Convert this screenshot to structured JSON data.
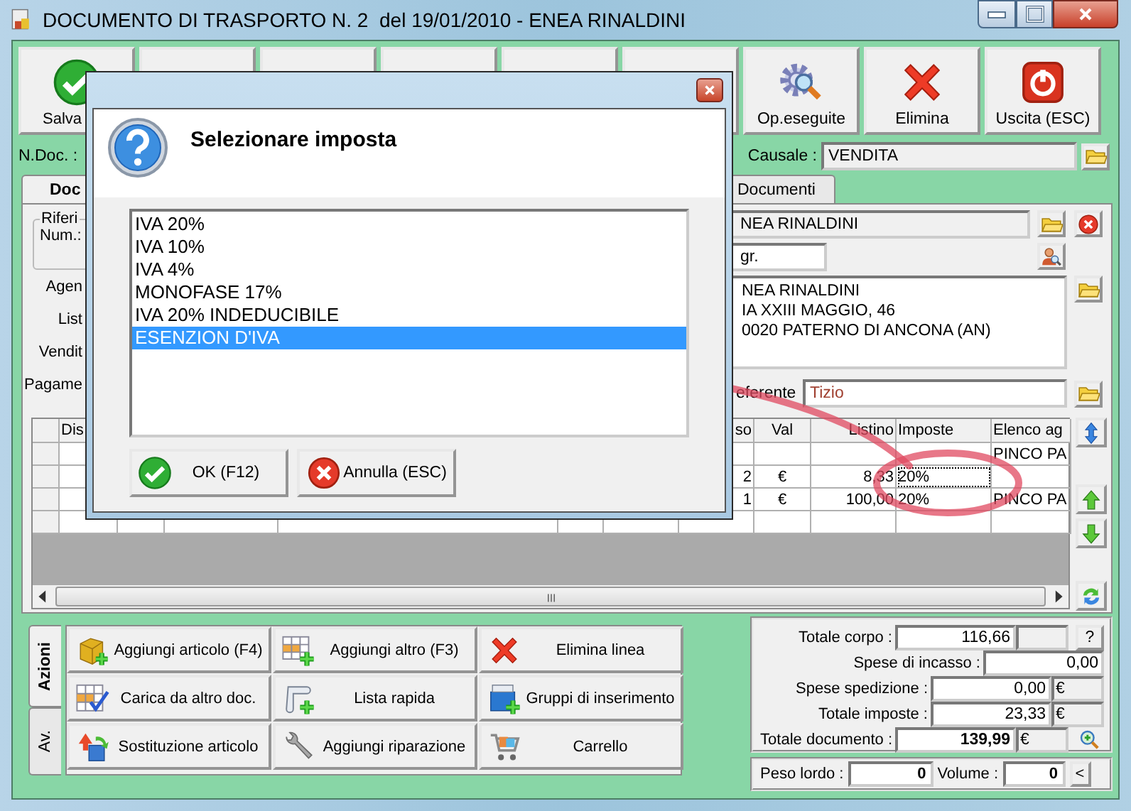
{
  "window": {
    "title": "DOCUMENTO DI TRASPORTO N. 2  del 19/01/2010 - ENEA RINALDINI"
  },
  "toolbar": [
    {
      "kind": "save",
      "label": "Salva"
    },
    {
      "kind": "covered"
    },
    {
      "kind": "covered"
    },
    {
      "kind": "covered"
    },
    {
      "kind": "covered"
    },
    {
      "kind": "covered"
    },
    {
      "kind": "gears",
      "label": "Op.eseguite"
    },
    {
      "kind": "delete",
      "label": "Elimina"
    },
    {
      "kind": "exit",
      "label": "Uscita (ESC)"
    }
  ],
  "header": {
    "ndoc_label": "N.Doc. :",
    "causale_label": "Causale :",
    "causale": "VENDITA"
  },
  "tabs": [
    {
      "label": "Doc",
      "selected": true
    },
    {
      "label": "Documenti",
      "selected": false
    }
  ],
  "document": {
    "group_label": "Riferi",
    "num_label": "Num.:",
    "left_labels": [
      "Agen",
      "List",
      "Vendit",
      "Pagame"
    ],
    "customer": "NEA RINALDINI",
    "title_field": "gr.",
    "address": [
      "NEA RINALDINI",
      "IA XXIII MAGGIO, 46",
      "0020 PATERNO DI ANCONA (AN)"
    ],
    "referente_label": "eferente",
    "referente": "Tizio"
  },
  "grid": {
    "columns": [
      "Dis",
      "so",
      "Val",
      "Listino",
      "Imposte",
      "Elenco ag"
    ],
    "rows": [
      {
        "elenco": "PINCO PA",
        "focused": false
      },
      {
        "so": "2",
        "val": "€",
        "listino": "8,33",
        "imposte": "20%",
        "focused": true
      },
      {
        "so": "1",
        "val": "€",
        "listino": "100,00",
        "imposte": "20%",
        "elenco": "PINCO PA",
        "focused": false
      }
    ]
  },
  "actions": {
    "tabs": [
      {
        "label": "Azioni",
        "selected": true
      },
      {
        "label": "Av.",
        "selected": false
      }
    ],
    "buttons": [
      {
        "kind": "cube-add",
        "label": "Aggiungi articolo (F4)"
      },
      {
        "kind": "grid-add",
        "label": "Aggiungi altro (F3)"
      },
      {
        "kind": "delete",
        "label": "Elimina linea"
      },
      {
        "kind": "grid-check",
        "label": "Carica da altro doc."
      },
      {
        "kind": "scroll-add",
        "label": "Lista rapida"
      },
      {
        "kind": "box-add",
        "label": "Gruppi di inserimento"
      },
      {
        "kind": "swap",
        "label": "Sostituzione articolo"
      },
      {
        "kind": "wrench",
        "label": "Aggiungi riparazione"
      },
      {
        "kind": "cart",
        "label": "Carrello"
      }
    ]
  },
  "totals": {
    "rows": [
      {
        "kind": "corpo",
        "label": "Totale corpo :",
        "value": "116,66",
        "button": "?"
      },
      {
        "kind": "plain",
        "label": "Spese di incasso :",
        "value": "0,00"
      },
      {
        "kind": "currency",
        "label": "Spese spedizione :",
        "value": "0,00",
        "currency": "€"
      },
      {
        "kind": "currency",
        "label": "Totale imposte :",
        "value": "23,33",
        "currency": "€"
      },
      {
        "kind": "total",
        "label": "Totale documento :",
        "value": "139,99",
        "currency": "€"
      }
    ],
    "peso_label": "Peso lordo :",
    "peso": "0",
    "volume_label": "Volume :",
    "volume": "0",
    "toggle": "<"
  },
  "dialog": {
    "heading": "Selezionare imposta",
    "items": [
      {
        "label": "IVA 20%",
        "selected": false
      },
      {
        "label": "IVA 10%",
        "selected": false
      },
      {
        "label": "IVA 4%",
        "selected": false
      },
      {
        "label": "MONOFASE 17%",
        "selected": false
      },
      {
        "label": "IVA 20% INDEDUCIBILE",
        "selected": false
      },
      {
        "label": "ESENZION D'IVA",
        "selected": true
      }
    ],
    "ok": "OK (F12)",
    "cancel": "Annulla (ESC)"
  }
}
